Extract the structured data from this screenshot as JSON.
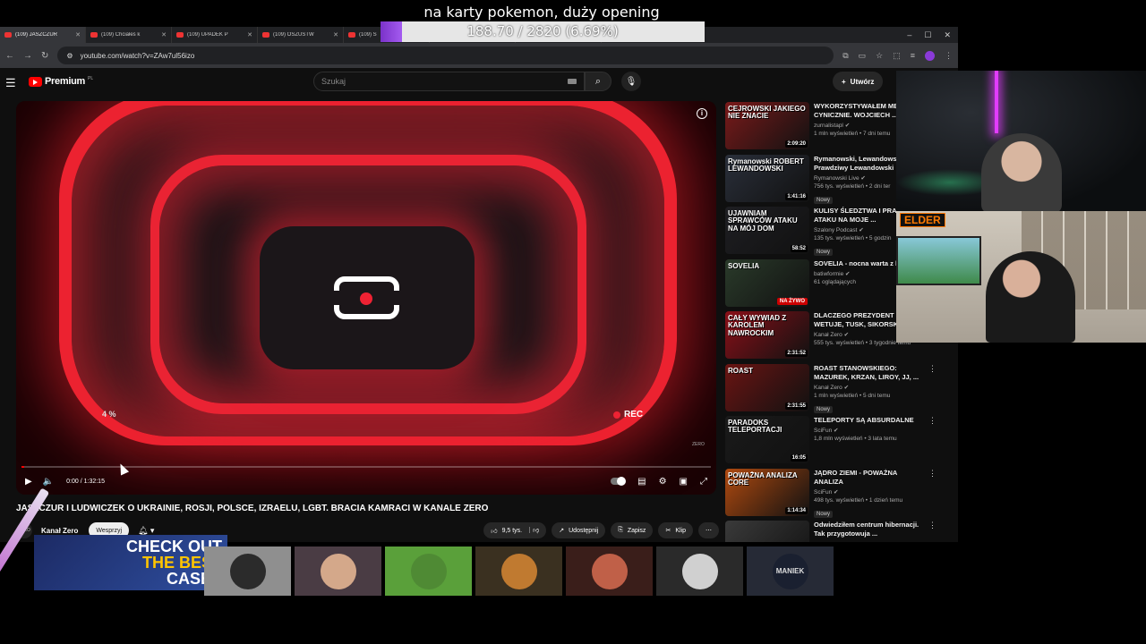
{
  "overlay": {
    "goal_title": "na karty pokemon, duży opening",
    "goal_progress_text": "188.70 / 2820 (6.69%)",
    "goal_fraction": 0.0669
  },
  "browser": {
    "tabs": [
      {
        "title": "(109) JASZCZUR",
        "active": true
      },
      {
        "title": "(109) Chciałeś k",
        "active": false
      },
      {
        "title": "(109) UPADEK P",
        "active": false
      },
      {
        "title": "(109) OSZUSTW",
        "active": false
      },
      {
        "title": "(109) Ś",
        "active": false
      },
      {
        "title": "(109) Jak VIP Wię",
        "active": false
      },
      {
        "title": "(109) Whistlindie",
        "active": false
      }
    ],
    "url": "youtube.com/watch?v=ZAw7ul56izo"
  },
  "youtube": {
    "logo_text": "Premium",
    "logo_country": "PL",
    "search_placeholder": "Szukaj",
    "create_label": "Utwórz",
    "player": {
      "percent_label": "4 %",
      "rec_label": "REC",
      "watermark": "ZERO",
      "time": "0:00 / 1:32:15",
      "progress_fraction": 0.0
    },
    "video_title": "JASZCZUR I LUDWICZEK O UKRAINIE, ROSJI, POLSCE, IZRAELU, LGBT. BRACIA KAMRACI W KANALE ZERO",
    "channel_name": "Kanał Zero",
    "channel_avatar": "ZERO",
    "support_label": "Wesprzyj",
    "actions": {
      "likes": "9,5 tys.",
      "share": "Udostępnij",
      "save": "Zapisz",
      "clip": "Klip"
    },
    "recommendations": [
      {
        "title": "WYKORZYSTYWAŁEM MĘ CYNICZNIE. WOJCIECH ...",
        "channel": "zurnalistapl",
        "stats": "1 mln wyświetleń • 7 dni temu",
        "duration": "2:09:20",
        "thumb_text": "CEJROWSKI JAKIEGO NIE ZNACIE",
        "thumb_color": "#7a1a1a",
        "badge": ""
      },
      {
        "title": "Rymanowski, Lewandows Prawdziwy Lewandowski",
        "channel": "Rymanowski Live",
        "stats": "756 tys. wyświetleń • 2 dni ter",
        "duration": "1:41:16",
        "thumb_text": "Rymanowski ROBERT LEWANDOWSKI",
        "thumb_color": "#2a2f3a",
        "badge": "Nowy"
      },
      {
        "title": "KULISY ŚLEDZTWA I PRAW O ATAKU NA MOJE ...",
        "channel": "Szalony Podcast",
        "stats": "135 tys. wyświetleń • 5 godzin",
        "duration": "58:52",
        "thumb_text": "UJAWNIAM SPRAWCÓW ATAKU NA MÓJ DOM",
        "thumb_color": "#1e1e22",
        "badge": "Nowy"
      },
      {
        "title": "SOVELIA - nocna warta z b",
        "channel": "batiwformie",
        "stats": "61 oglądających",
        "duration": "NA ŻYWO",
        "thumb_text": "SOVELIA",
        "thumb_color": "#2a3a2a",
        "badge": ""
      },
      {
        "title": "DLACZEGO PREZYDENT WETUJE, TUSK, SIKORSKI",
        "channel": "Kanał Zero",
        "stats": "555 tys. wyświetleń • 3 tygodnie temu",
        "duration": "2:31:52",
        "thumb_text": "CAŁY WYWIAD Z KAROLEM NAWROCKIM",
        "thumb_color": "#8a1018",
        "badge": ""
      },
      {
        "title": "ROAST STANOWSKIEGO: MAZUREK, KRZAN, LIROY, JJ, ...",
        "channel": "Kanał Zero",
        "stats": "1 mln wyświetleń • 5 dni temu",
        "duration": "2:31:55",
        "thumb_text": "ROAST",
        "thumb_color": "#6a1412",
        "badge": "Nowy"
      },
      {
        "title": "TELEPORTY SĄ ABSURDALNE",
        "channel": "SciFun",
        "stats": "1,8 mln wyświetleń • 3 lata temu",
        "duration": "16:05",
        "thumb_text": "PARADOKS TELEPORTACJI",
        "thumb_color": "#1a1a1a",
        "badge": ""
      },
      {
        "title": "JĄDRO ZIEMI - POWAŻNA ANALIZA",
        "channel": "SciFun",
        "stats": "498 tys. wyświetleń • 1 dzień temu",
        "duration": "1:14:34",
        "thumb_text": "POWAŻNA ANALIZA CORE",
        "thumb_color": "#b04a10",
        "badge": "Nowy"
      },
      {
        "title": "Odwiedziłem centrum hibernacji. Tak przygotowuja ...",
        "channel": "",
        "stats": "",
        "duration": "",
        "thumb_text": "",
        "thumb_color": "#3a3a3a",
        "badge": ""
      }
    ]
  },
  "webcam": {
    "overlay_tag": "ELDER"
  },
  "promo": {
    "line1": "CHECK OUT",
    "line2": "THE BEST",
    "line3": "CASES"
  },
  "emotes": [
    {
      "name": "car",
      "bg": "#8f8f8f",
      "face": "#2b2b2b"
    },
    {
      "name": "face-glasses",
      "bg": "#4a3c44",
      "face": "#d4a88a"
    },
    {
      "name": "pepe",
      "bg": "#5aa03a",
      "face": "#4f8a34"
    },
    {
      "name": "character-orange",
      "bg": "#3a3020",
      "face": "#c07a30"
    },
    {
      "name": "gamer",
      "bg": "#3a1e1a",
      "face": "#c06048"
    },
    {
      "name": "woman",
      "bg": "#2a2a2a",
      "face": "#d0d0d0"
    },
    {
      "name": "maniek",
      "bg": "#262a36",
      "face": "#1a2030"
    }
  ],
  "emote_text": {
    "maniek": "MANIEK"
  }
}
